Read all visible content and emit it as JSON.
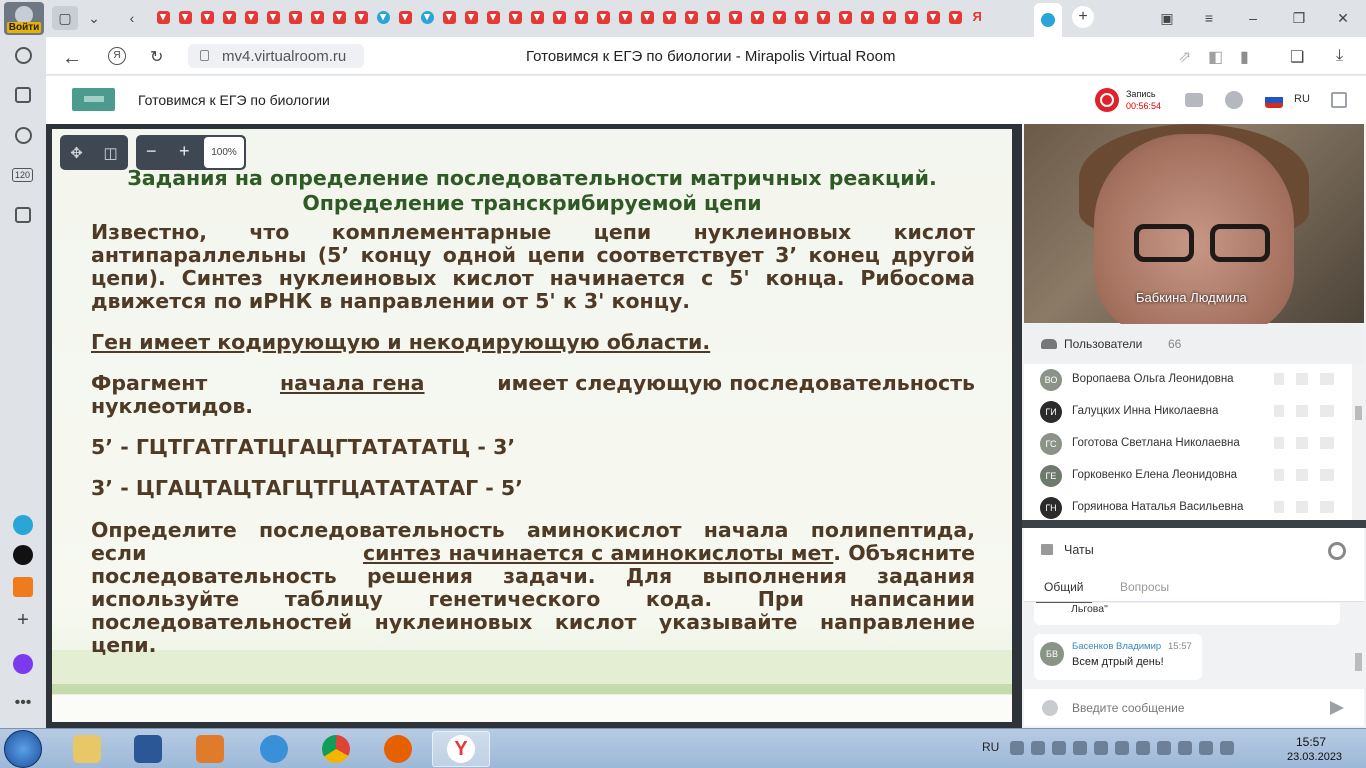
{
  "browser": {
    "login_label": "Войти",
    "url": "mv4.virtualroom.ru",
    "tab_title": "Готовимся к ЕГЭ по биологии - Mirapolis Virtual Room",
    "side_counter": "120"
  },
  "header": {
    "room_name": "Готовимся к ЕГЭ по биологии",
    "recording_label": "Запись",
    "recording_time": "00:56:54",
    "language": "RU",
    "flag_colors": [
      "#ffffff",
      "#1c57c4",
      "#d52b1e"
    ]
  },
  "viewer": {
    "zoom_level": "100%"
  },
  "slide": {
    "title_line1": "Задания на определение последовательности матричных реакций.",
    "title_line2": "Определение транскрибируемой цепи",
    "para1_lines": [
      "Известно, что комплементарные цепи нуклеиновых кислот",
      "антипараллельны (5’ концу одной цепи соответствует 3’ конец другой",
      "цепи). Синтез нуклеиновых кислот начинается с 5' конца. Рибосома",
      "движется по иРНК в направлении от 5' к 3' концу."
    ],
    "gene_line": "Ген имеет кодирующую и некодирующую области.",
    "fragment_pre": "Фрагмент",
    "fragment_underlined": "начала гена",
    "fragment_post": "имеет следующую последовательность",
    "fragment_line2": "нуклеотидов.",
    "seq1": "5’ - ГЦТГАТГАТЦГАЦГТАТАТАТЦ - 3’",
    "seq2": "3’ - ЦГАЦТАЦТАГЦТГЦАТАТАТАГ - 5’",
    "task_line1": "Определите последовательность аминокислот начала полипептида,",
    "task_if": "если",
    "task_underlined": "синтез начинается с аминокислоты мет",
    "task_after": ". Объясните",
    "task_lines_rest": [
      "последовательность решения задачи. Для выполнения задания",
      "используйте таблицу генетического кода. При написании",
      "последовательностей нуклеиновых кислот указывайте направление"
    ],
    "task_last": "цепи."
  },
  "video": {
    "presenter_name": "Бабкина Людмила"
  },
  "users": {
    "title": "Пользователи",
    "count": "66",
    "items": [
      {
        "initials": "ВО",
        "name": "Воропаева Ольга Леонидовна",
        "color": "#8a9486"
      },
      {
        "initials": "ГИ",
        "name": "Галуцких Инна Николаевна",
        "color": "#2b2b2b"
      },
      {
        "initials": "ГС",
        "name": "Гоготова Светлана Николаевна",
        "color": "#8a9486"
      },
      {
        "initials": "ГЕ",
        "name": "Горковенко Елена Леонидовна",
        "color": "#6e7a6c"
      },
      {
        "initials": "ГН",
        "name": "Горяинова Наталья Васильевна",
        "color": "#2b2b2b"
      }
    ]
  },
  "chat": {
    "title": "Чаты",
    "tab_general": "Общий",
    "tab_questions": "Вопросы",
    "prev_message_tail": "Льгова\"",
    "message": {
      "initials": "БВ",
      "author": "Басенков Владимир",
      "time": "15:57",
      "text": "Всем дтрый день!"
    },
    "input_placeholder": "Введите сообщение"
  },
  "taskbar": {
    "lang": "RU",
    "time": "15:57",
    "date": "23.03.2023"
  }
}
